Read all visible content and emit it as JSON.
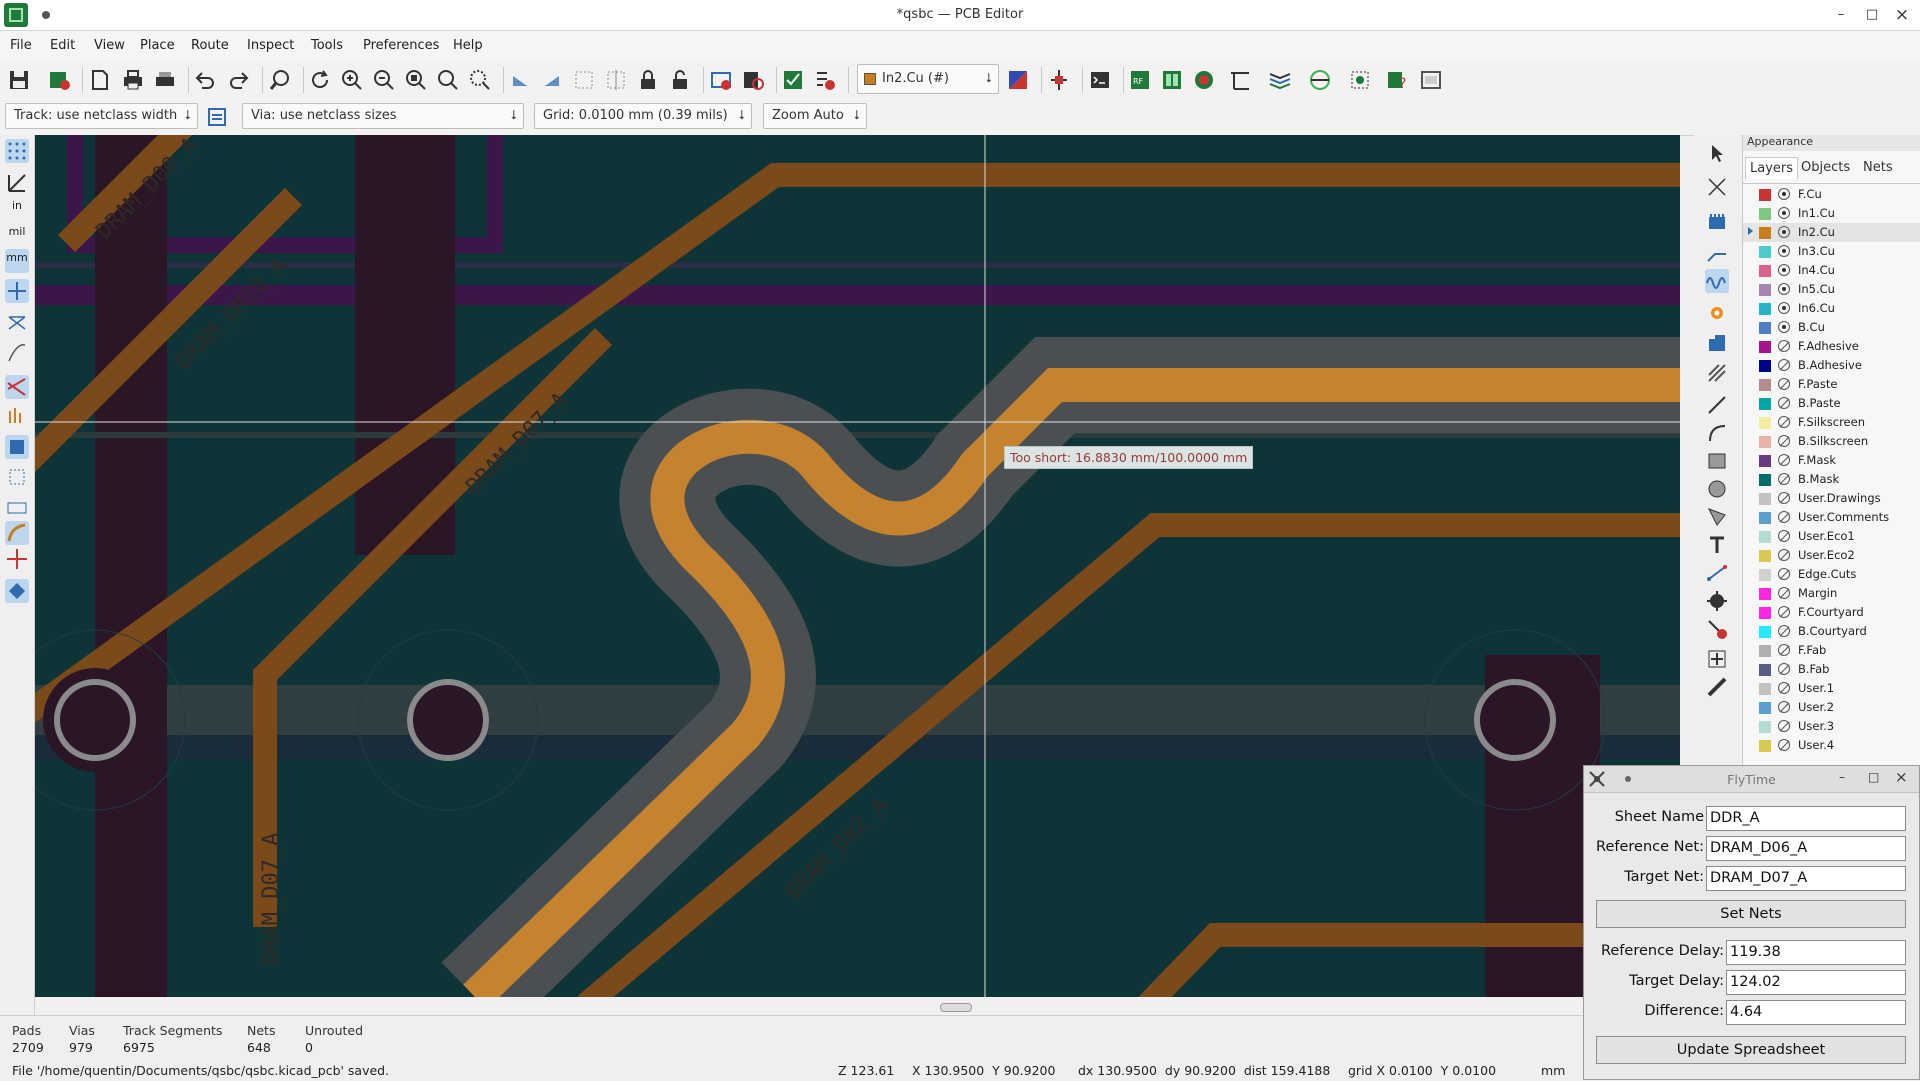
{
  "window": {
    "title": "*qsbc — PCB Editor",
    "minimize": "–",
    "maximize": "□",
    "close": "×"
  },
  "menu": [
    "File",
    "Edit",
    "View",
    "Place",
    "Route",
    "Inspect",
    "Tools",
    "Preferences",
    "Help"
  ],
  "toolbar": {
    "layer_select": "In2.Cu (#)",
    "layer_color": "#c87e1e"
  },
  "toolbar2": {
    "track": "Track: use netclass width",
    "via": "Via: use netclass sizes",
    "grid": "Grid: 0.0100 mm (0.39 mils)",
    "zoom": "Zoom Auto"
  },
  "left_toolbar": {
    "units_in": "in",
    "units_mil": "mil",
    "units_mm": "mm"
  },
  "canvas": {
    "tooltip": "Too short: 16.8830 mm/100.0000 mm",
    "net_labels": [
      "DRAM_D00_A",
      "DRAM_DMI0_A",
      "DRAM_D07_A",
      "DRAM_D07_A",
      "DRAM_D02_A"
    ],
    "colors": {
      "background": "#0f3438",
      "active_copper": "#c5822f",
      "other_copper": "#7a4a1a",
      "clearance": "#4a4f52",
      "pad_dark": "#2a1626"
    }
  },
  "appearance": {
    "header": "Appearance",
    "tabs": [
      "Layers",
      "Objects",
      "Nets"
    ],
    "active_tab": "Layers",
    "layers": [
      {
        "name": "F.Cu",
        "color": "#c83434",
        "visible": true
      },
      {
        "name": "In1.Cu",
        "color": "#7fc87f",
        "visible": true
      },
      {
        "name": "In2.Cu",
        "color": "#c87e1e",
        "visible": true,
        "selected": true
      },
      {
        "name": "In3.Cu",
        "color": "#4fcbcb",
        "visible": true
      },
      {
        "name": "In4.Cu",
        "color": "#db628b",
        "visible": true
      },
      {
        "name": "In5.Cu",
        "color": "#a586b0",
        "visible": true
      },
      {
        "name": "In6.Cu",
        "color": "#28b4c8",
        "visible": true
      },
      {
        "name": "B.Cu",
        "color": "#4d7fc4",
        "visible": true
      },
      {
        "name": "F.Adhesive",
        "color": "#a4148c",
        "visible": false
      },
      {
        "name": "B.Adhesive",
        "color": "#00008a",
        "visible": false
      },
      {
        "name": "F.Paste",
        "color": "#b48c8c",
        "visible": false
      },
      {
        "name": "B.Paste",
        "color": "#00a7a7",
        "visible": false
      },
      {
        "name": "F.Silkscreen",
        "color": "#f2eda1",
        "visible": false
      },
      {
        "name": "B.Silkscreen",
        "color": "#e8b2a7",
        "visible": false
      },
      {
        "name": "F.Mask",
        "color": "#6b3a84",
        "visible": false
      },
      {
        "name": "B.Mask",
        "color": "#006d6a",
        "visible": false
      },
      {
        "name": "User.Drawings",
        "color": "#c2c2c2",
        "visible": false
      },
      {
        "name": "User.Comments",
        "color": "#599fd1",
        "visible": false
      },
      {
        "name": "User.Eco1",
        "color": "#b4dbd2",
        "visible": false
      },
      {
        "name": "User.Eco2",
        "color": "#d8c852",
        "visible": false
      },
      {
        "name": "Edge.Cuts",
        "color": "#d0d2cd",
        "visible": false
      },
      {
        "name": "Margin",
        "color": "#ff26e2",
        "visible": false
      },
      {
        "name": "F.Courtyard",
        "color": "#ff26e2",
        "visible": false
      },
      {
        "name": "B.Courtyard",
        "color": "#26e9ff",
        "visible": false
      },
      {
        "name": "F.Fab",
        "color": "#afafaf",
        "visible": false
      },
      {
        "name": "B.Fab",
        "color": "#585d84",
        "visible": false
      },
      {
        "name": "User.1",
        "color": "#c2c2c2",
        "visible": false
      },
      {
        "name": "User.2",
        "color": "#599fd1",
        "visible": false
      },
      {
        "name": "User.3",
        "color": "#b4dbd2",
        "visible": false
      },
      {
        "name": "User.4",
        "color": "#d8c852",
        "visible": false
      }
    ]
  },
  "status": {
    "headers": [
      "Pads",
      "Vias",
      "Track Segments",
      "Nets",
      "Unrouted"
    ],
    "values": [
      "2709",
      "979",
      "6975",
      "648",
      "0"
    ],
    "message": "File '/home/quentin/Documents/qsbc/qsbc.kicad_pcb' saved.",
    "zoom": "Z 123.61",
    "xy": "X 130.9500  Y 90.9200",
    "delta": "dx 130.9500  dy 90.9200  dist 159.4188",
    "grid": "grid X 0.0100  Y 0.0100",
    "units": "mm"
  },
  "flytime": {
    "title": "FlyTime",
    "sheet_label": "Sheet Name",
    "sheet_value": "DDR_A",
    "ref_label": "Reference Net:",
    "ref_value": "DRAM_D06_A",
    "target_label": "Target Net:",
    "target_value": "DRAM_D07_A",
    "set_nets": "Set Nets",
    "ref_delay_label": "Reference Delay:",
    "ref_delay_value": "119.38",
    "target_delay_label": "Target Delay:",
    "target_delay_value": "124.02",
    "diff_label": "Difference:",
    "diff_value": "4.64",
    "update": "Update Spreadsheet"
  }
}
